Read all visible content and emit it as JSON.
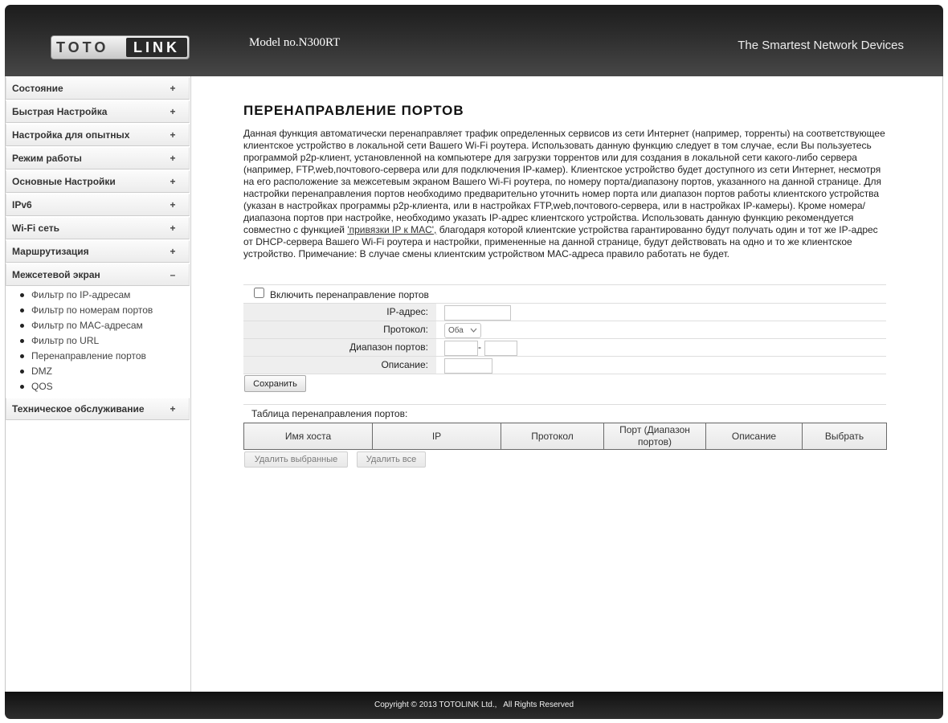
{
  "header": {
    "logo_left": "TOTO",
    "logo_right": "LINK",
    "model": "Model no.N300RT",
    "slogan": "The Smartest Network Devices"
  },
  "sidebar": {
    "items": [
      {
        "label": "Состояние",
        "toggle": "+"
      },
      {
        "label": "Быстрая Настройка",
        "toggle": "+"
      },
      {
        "label": "Настройка для опытных",
        "toggle": "+"
      },
      {
        "label": "Режим работы",
        "toggle": "+"
      },
      {
        "label": "Основные Настройки",
        "toggle": "+"
      },
      {
        "label": "IPv6",
        "toggle": "+"
      },
      {
        "label": "Wi-Fi сеть",
        "toggle": "+"
      },
      {
        "label": "Маршрутизация",
        "toggle": "+"
      },
      {
        "label": "Межсетевой экран",
        "toggle": "–"
      },
      {
        "label": "Техническое обслуживание",
        "toggle": "+"
      }
    ],
    "firewall_sub": [
      "Фильтр по IP-адресам",
      "Фильтр по номерам портов",
      "Фильтр по MAC-адресам",
      "Фильтр по URL",
      "Перенаправление портов",
      "DMZ",
      "QOS"
    ]
  },
  "page": {
    "title": "ПЕРЕНАПРАВЛЕНИЕ ПОРТОВ",
    "desc_before": "Данная функция автоматически перенаправляет трафик определенных сервисов из сети Интернет (например, торренты) на соответствующее клиентское устройство в локальной сети Вашего Wi-Fi роутера. Использовать данную функцию следует в том случае, если Вы пользуетесь программой p2p-клиент, установленной на компьютере для загрузки торрентов или для создания в локальной сети какого-либо сервера (например, FTP,web,почтового-сервера или для подключения IP-камер). Клиентское устройство будет доступного из сети Интернет, несмотря на его расположение за межсетевым экраном Вашего Wi-Fi роутера, по номеру порта/диапазону портов, указанного на данной странице. Для настройки перенаправления портов необходимо предварительно уточнить номер порта или диапазон портов работы клиентского устройства (указан в настройках программы p2p-клиента, или в настройках FTP,web,почтового-сервера, или в настройках IP-камеры). Кроме номера/диапазона портов при настройке, необходимо указать IP-адрес клиентского устройства. Использовать данную функцию рекомендуется совместно с функцией ",
    "desc_link": "'привязки IP к MAC',",
    "desc_after": " благодаря которой клиентские устройства гарантированно будут получать один и тот же IP-адрес от DHCP-сервера Вашего Wi-Fi роутера и настройки, примененные на данной странице, будут действовать на одно и то же клиентское устройство. Примечание: В случае смены клиентским устройством MAC-адреса правило работать не будет."
  },
  "form": {
    "enable_label": "Включить перенаправление портов",
    "enable_checked": false,
    "ip_label": "IP-адрес:",
    "ip_value": "",
    "protocol_label": "Протокол:",
    "protocol_value": "Оба",
    "range_label": "Диапазон портов:",
    "range_sep": "-",
    "range_from": "",
    "range_to": "",
    "desc_label": "Описание:",
    "desc_value": "",
    "save": "Сохранить"
  },
  "table": {
    "caption": "Таблица перенаправления портов:",
    "headers": [
      "Имя хоста",
      "IP",
      "Протокол",
      "Порт (Диапазон портов)",
      "Описание",
      "Выбрать"
    ],
    "rows": []
  },
  "actions": {
    "delete_selected": "Удалить выбранные",
    "delete_all": "Удалить все"
  },
  "footer": {
    "copyright": "Copyright © 2013 TOTOLINK Ltd.,   All Rights Reserved"
  },
  "icons": {
    "protocol_select": "chevron-down-icon",
    "bullets": "bullet-icon"
  },
  "colors": {
    "header_bg": "#2c2c2c",
    "footer_bg": "#1e1e1e",
    "form_label_bg": "#eeeeee"
  }
}
